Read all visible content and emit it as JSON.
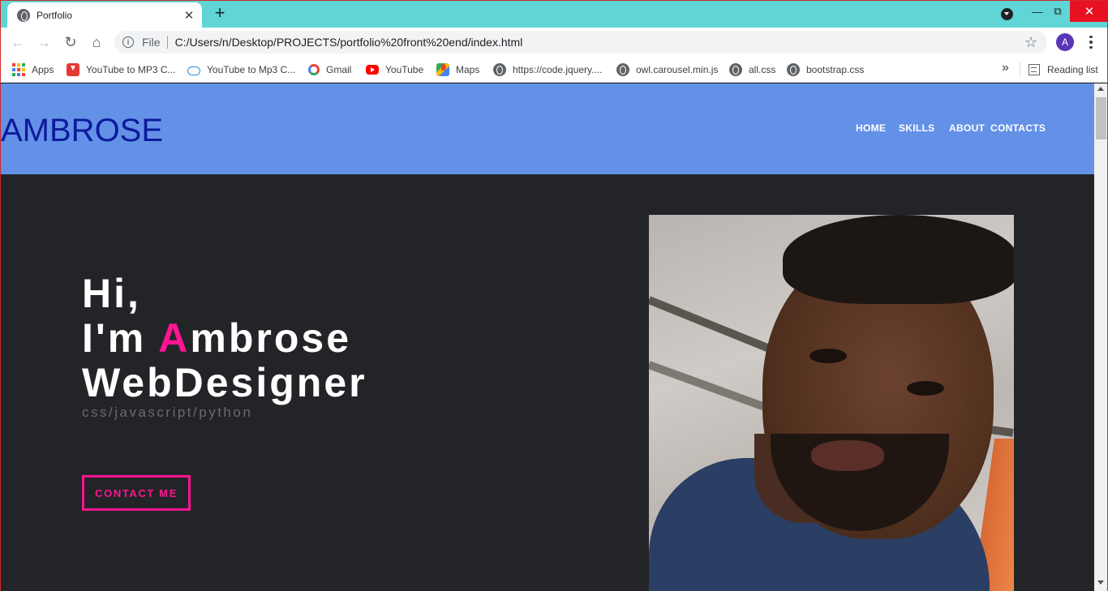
{
  "browser": {
    "tab_title": "Portfolio",
    "tab_close": "✕",
    "new_tab": "+",
    "file_label": "File",
    "url": "C:/Users/n/Desktop/PROJECTS/portfolio%20front%20end/index.html",
    "profile_initial": "A",
    "bookmarks_more": "»",
    "bookmarks": [
      {
        "label": "Apps",
        "icon": "apps-grid-icon"
      },
      {
        "label": "YouTube to MP3 C...",
        "icon": "download-icon"
      },
      {
        "label": "YouTube to Mp3 C...",
        "icon": "cloud-download-icon"
      },
      {
        "label": "Gmail",
        "icon": "google-icon"
      },
      {
        "label": "YouTube",
        "icon": "youtube-icon"
      },
      {
        "label": "Maps",
        "icon": "maps-icon"
      },
      {
        "label": "https://code.jquery....",
        "icon": "globe-icon"
      },
      {
        "label": "owl.carousel.min.js",
        "icon": "globe-icon"
      },
      {
        "label": "all.css",
        "icon": "globe-icon"
      },
      {
        "label": "bootstrap.css",
        "icon": "globe-icon"
      }
    ],
    "reading_list": "Reading list"
  },
  "site": {
    "brand": "AMBROSE",
    "nav": [
      "HOME",
      "SKILLS",
      "ABOUT",
      "CONTACTS"
    ],
    "hero": {
      "line1": "Hi,",
      "line2_prefix": "I'm ",
      "line2_accent": "A",
      "line2_suffix": "mbrose",
      "line3": "WebDesigner",
      "subtitle": "css/javascript/python",
      "button": "CONTACT ME"
    }
  },
  "colors": {
    "header_bg": "#6491e8",
    "brand_text": "#0d1a9b",
    "page_bg": "#232427",
    "accent": "#ff1493",
    "tabstrip": "#5fd5d6"
  }
}
